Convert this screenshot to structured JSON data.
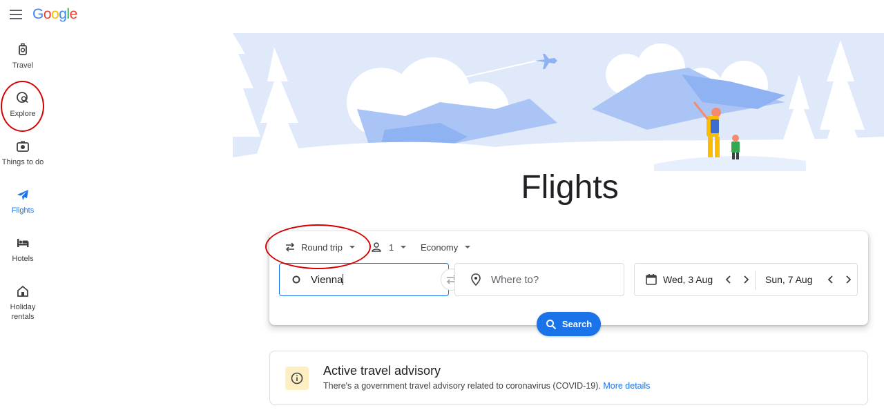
{
  "header": {
    "logo": [
      "G",
      "o",
      "o",
      "g",
      "l",
      "e"
    ]
  },
  "sidebar": {
    "items": [
      {
        "label": "Travel",
        "icon": "luggage-icon"
      },
      {
        "label": "Explore",
        "icon": "explore-icon"
      },
      {
        "label": "Things to do",
        "icon": "camera-icon"
      },
      {
        "label": "Flights",
        "icon": "flight-icon",
        "active": true
      },
      {
        "label": "Hotels",
        "icon": "hotel-bed-icon"
      },
      {
        "label": "Holiday rentals",
        "icon": "house-icon"
      }
    ]
  },
  "main": {
    "title": "Flights",
    "trip_type": "Round trip",
    "passengers": "1",
    "cabin_class": "Economy",
    "origin_value": "Vienna",
    "destination_placeholder": "Where to?",
    "depart_date": "Wed, 3 Aug",
    "return_date": "Sun, 7 Aug",
    "search_label": "Search"
  },
  "advisory": {
    "title": "Active travel advisory",
    "text": "There's a government travel advisory related to coronavirus (COVID-19).",
    "link": "More details"
  },
  "colors": {
    "accent": "#1a73e8",
    "annotation": "#d50000",
    "advisory_bg": "#feefc3"
  }
}
